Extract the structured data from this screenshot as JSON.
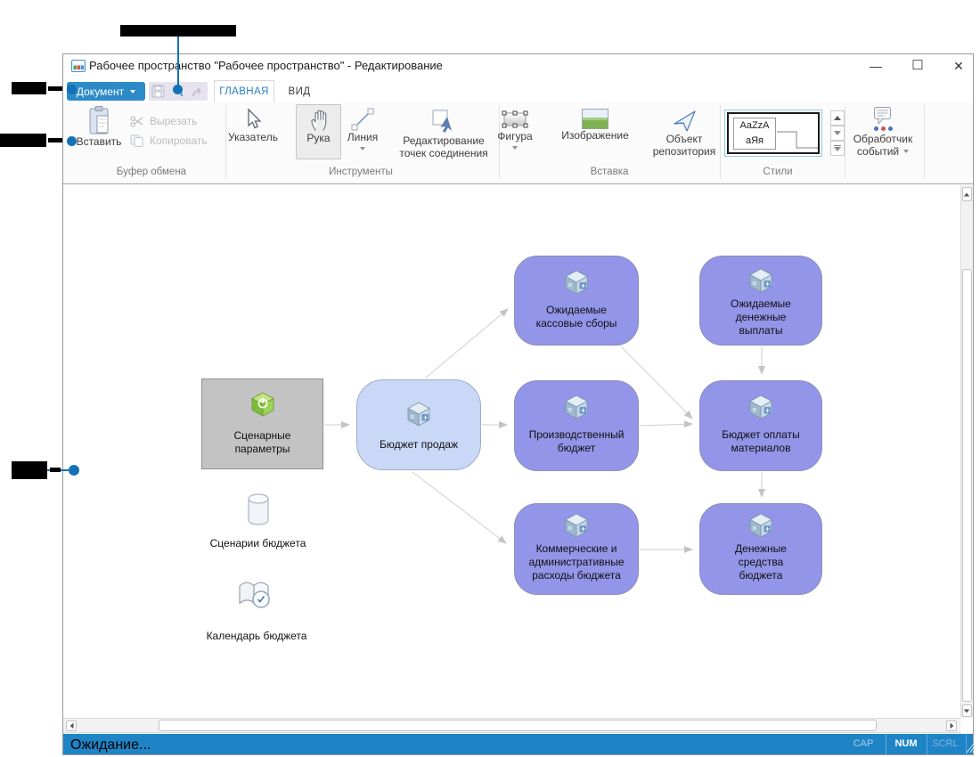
{
  "window": {
    "title": "Рабочее пространство \"Рабочее пространство\" - Редактирование",
    "controls": {
      "minimize": "—",
      "maximize": "☐",
      "close": "✕"
    }
  },
  "menu": {
    "document": "Документ",
    "tabs": {
      "home": "ГЛАВНАЯ",
      "view": "ВИД"
    }
  },
  "ribbon": {
    "clipboard": {
      "group": "Буфер обмена",
      "paste": "Вставить",
      "cut": "Вырезать",
      "copy": "Копировать"
    },
    "tools": {
      "group": "Инструменты",
      "pointer": "Указатель",
      "hand": "Рука",
      "line": "Линия",
      "edit_points_l1": "Редактирование",
      "edit_points_l2": "точек соединения"
    },
    "insert": {
      "group": "Вставка",
      "shape": "Фигура",
      "image": "Изображение",
      "repo_l1": "Объект",
      "repo_l2": "репозитория"
    },
    "styles": {
      "group": "Стили",
      "preview_l1": "AaZzA",
      "preview_l2": "аЯя"
    },
    "events": {
      "l1": "Обработчик",
      "l2": "событий"
    }
  },
  "diagram": {
    "nodes": [
      {
        "id": "scenario-parameters",
        "lines": [
          "Сценарные",
          "параметры"
        ]
      },
      {
        "id": "sales-budget",
        "lines": [
          "Бюджет продаж"
        ]
      },
      {
        "id": "expected-cash-receipts",
        "lines": [
          "Ожидаемые",
          "кассовые сборы"
        ]
      },
      {
        "id": "expected-cash-payments",
        "lines": [
          "Ожидаемые",
          "денежные",
          "выплаты"
        ]
      },
      {
        "id": "production-budget",
        "lines": [
          "Производственный",
          "бюджет"
        ]
      },
      {
        "id": "materials-payment-budget",
        "lines": [
          "Бюджет оплаты",
          "материалов"
        ]
      },
      {
        "id": "commercial-admin-expenses",
        "lines": [
          "Коммерческие и",
          "административные",
          "расходы бюджета"
        ]
      },
      {
        "id": "budget-cash",
        "lines": [
          "Денежные",
          "средства",
          "бюджета"
        ]
      }
    ],
    "items": [
      {
        "id": "budget-scenarios",
        "label": "Сценарии бюджета"
      },
      {
        "id": "budget-calendar",
        "label": "Календарь бюджета"
      }
    ]
  },
  "statusbar": {
    "status": "Ожидание...",
    "cap": "CAP",
    "num": "NUM",
    "scrl": "SCRL"
  },
  "colors": {
    "accent_blue": "#2d8ac8",
    "statusbar_blue": "#1e84c6",
    "node_purple": "#9295e8",
    "node_lightblue": "#c9d8f7",
    "node_gray": "#c3c3c3",
    "callout_blue": "#1272b5",
    "connector_gray": "#c9c9c9"
  }
}
